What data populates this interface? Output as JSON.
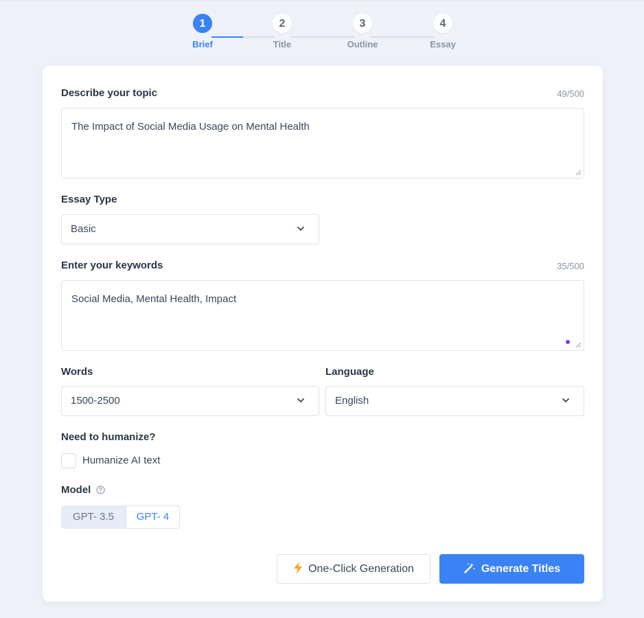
{
  "stepper": {
    "steps": [
      {
        "number": "1",
        "label": "Brief"
      },
      {
        "number": "2",
        "label": "Title"
      },
      {
        "number": "3",
        "label": "Outline"
      },
      {
        "number": "4",
        "label": "Essay"
      }
    ],
    "active_index": 0
  },
  "topic": {
    "label": "Describe your topic",
    "counter": "49/500",
    "value": "The Impact of Social Media Usage on Mental Health"
  },
  "essay_type": {
    "label": "Essay Type",
    "value": "Basic"
  },
  "keywords": {
    "label": "Enter your keywords",
    "counter": "35/500",
    "value": "Social Media, Mental Health, Impact"
  },
  "words": {
    "label": "Words",
    "value": "1500-2500"
  },
  "language": {
    "label": "Language",
    "value": "English"
  },
  "humanize": {
    "label": "Need to humanize?",
    "checkbox_label": "Humanize AI text",
    "checked": false
  },
  "model": {
    "label": "Model",
    "options": [
      "GPT- 3.5",
      "GPT- 4"
    ],
    "selected": "GPT- 4"
  },
  "actions": {
    "one_click_label": "One-Click Generation",
    "generate_label": "Generate Titles"
  },
  "colors": {
    "accent": "#3b82f6",
    "background": "#eef2f8",
    "lightning": "#f5a623",
    "dot": "#7c3aed"
  },
  "icons": [
    "chevron-down-icon",
    "help-circle-icon",
    "lightning-icon",
    "magic-wand-icon",
    "resize-handle-icon"
  ]
}
